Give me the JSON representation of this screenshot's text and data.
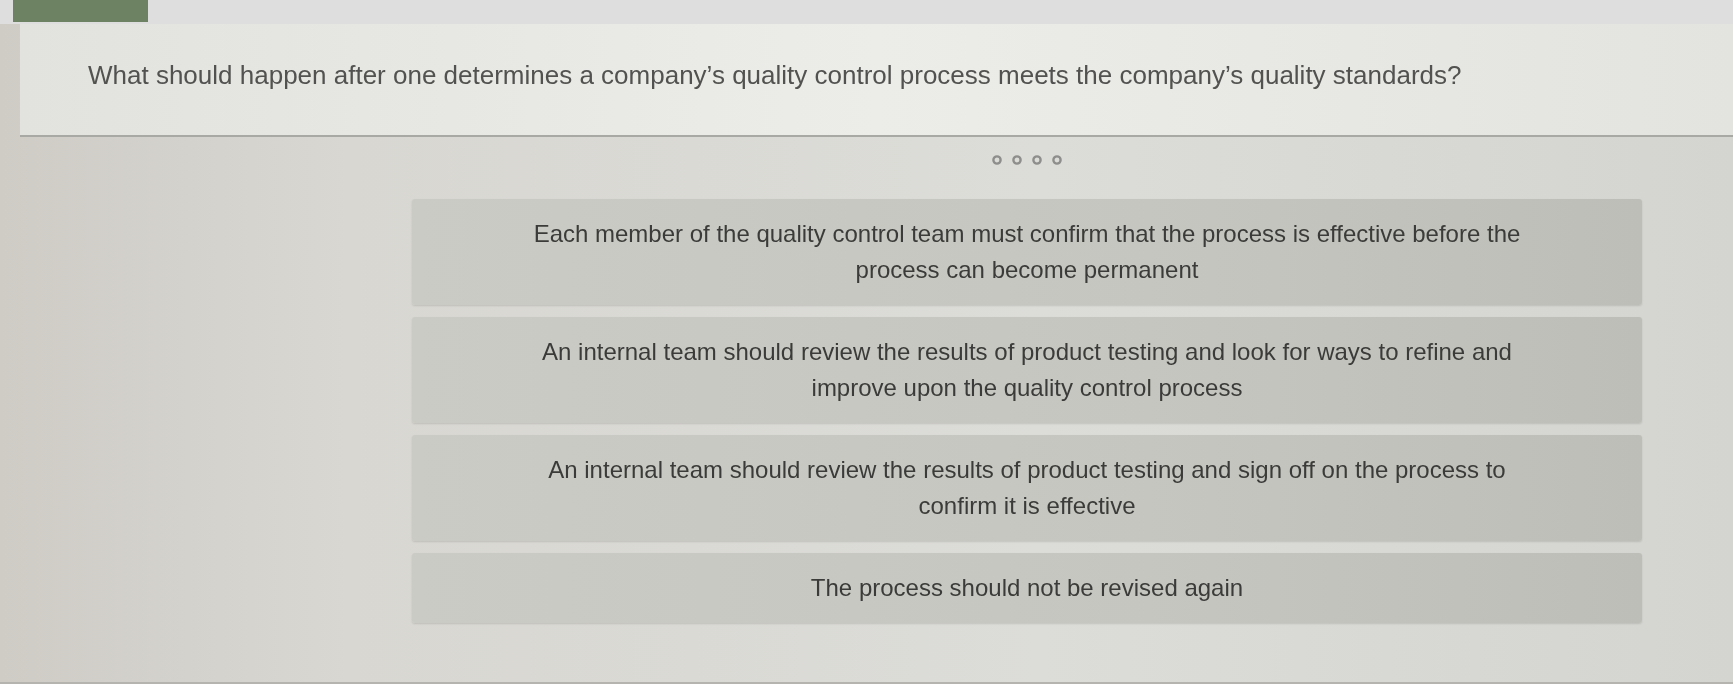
{
  "question": {
    "text": "What should happen after one determines a company’s quality control process meets the company’s quality standards?"
  },
  "answers": [
    {
      "text": "Each member of the quality control team must confirm that the process is effective before the process can become permanent"
    },
    {
      "text": "An internal team should review the results of product testing and look for ways to refine and improve upon the quality control process"
    },
    {
      "text": "An internal team should review the results of product testing and sign off on the process to confirm it is effective"
    },
    {
      "text": "The process should not be revised again"
    }
  ]
}
